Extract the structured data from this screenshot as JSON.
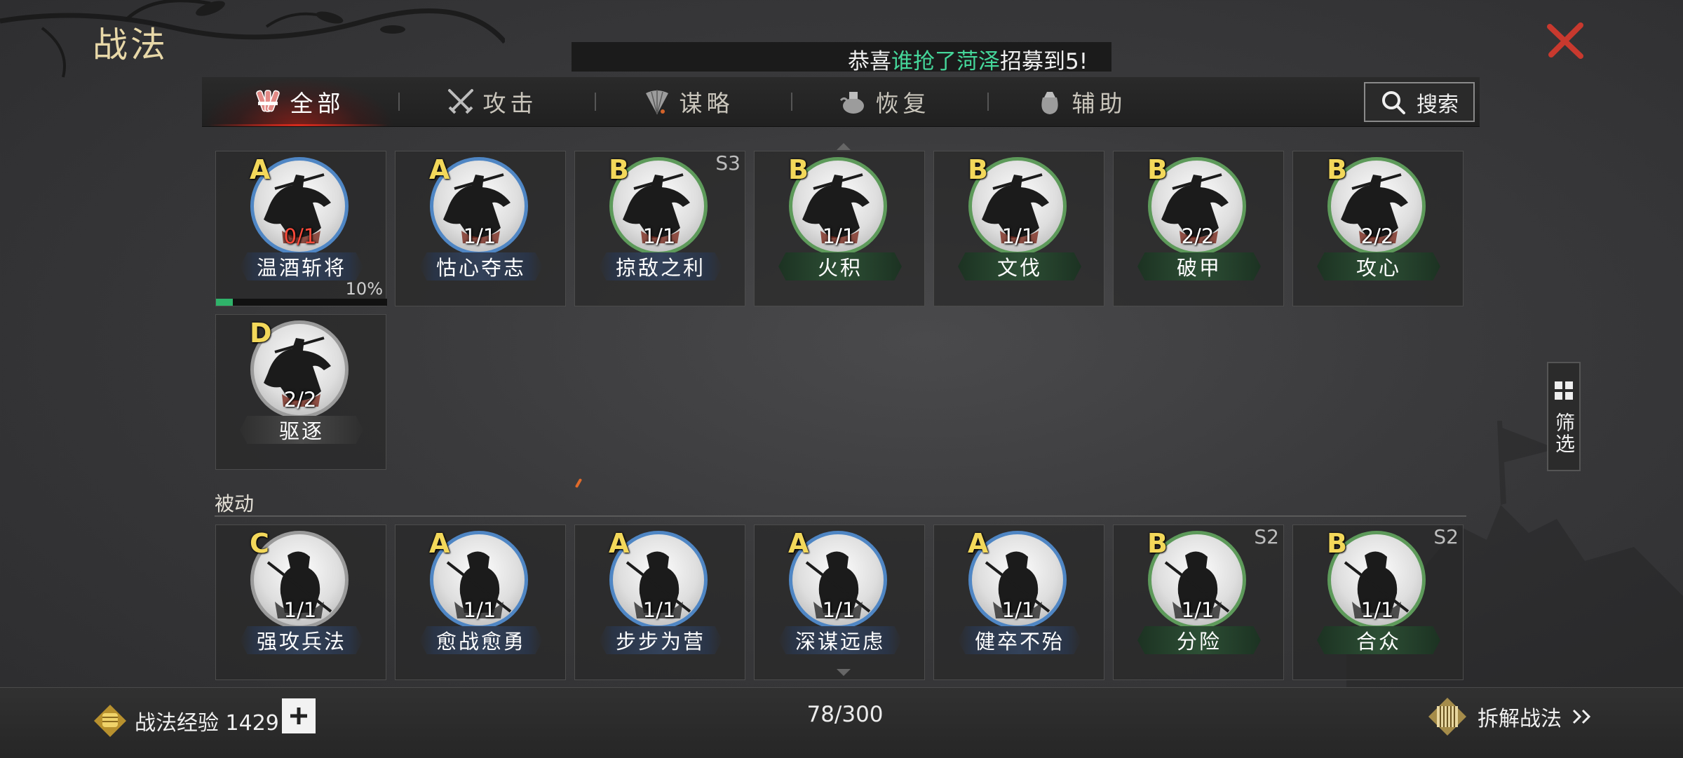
{
  "title": "战法",
  "ticker": {
    "prefix": "恭喜",
    "player": "谁抢了菏泽",
    "suffix": "招募到5!"
  },
  "tabs": [
    {
      "label": "全部",
      "icon": "scroll-bundle-icon"
    },
    {
      "label": "攻击",
      "icon": "crossed-swords-icon"
    },
    {
      "label": "谋略",
      "icon": "feather-fan-icon"
    },
    {
      "label": "恢复",
      "icon": "medicine-pot-icon"
    },
    {
      "label": "辅助",
      "icon": "pouch-icon"
    }
  ],
  "search": {
    "label": "搜索"
  },
  "active_skills": [
    {
      "grade": "A",
      "count": "0/1",
      "name": "温酒斩将",
      "progress": "10%",
      "progress_value": 0.1
    },
    {
      "grade": "A",
      "count": "1/1",
      "name": "怙心夺志"
    },
    {
      "grade": "B",
      "count": "1/1",
      "name": "掠敌之利",
      "season": "S3"
    },
    {
      "grade": "B",
      "count": "1/1",
      "name": "火积"
    },
    {
      "grade": "B",
      "count": "1/1",
      "name": "文伐"
    },
    {
      "grade": "B",
      "count": "2/2",
      "name": "破甲"
    },
    {
      "grade": "B",
      "count": "2/2",
      "name": "攻心"
    },
    {
      "grade": "D",
      "count": "2/2",
      "name": "驱逐"
    }
  ],
  "passive_section": {
    "label": "被动"
  },
  "passive_skills": [
    {
      "grade": "C",
      "count": "1/1",
      "name": "强攻兵法"
    },
    {
      "grade": "A",
      "count": "1/1",
      "name": "愈战愈勇"
    },
    {
      "grade": "A",
      "count": "1/1",
      "name": "步步为营"
    },
    {
      "grade": "A",
      "count": "1/1",
      "name": "深谋远虑"
    },
    {
      "grade": "A",
      "count": "1/1",
      "name": "健卒不殆"
    },
    {
      "grade": "B",
      "count": "1/1",
      "name": "分险",
      "season": "S2"
    },
    {
      "grade": "B",
      "count": "1/1",
      "name": "合众",
      "season": "S2"
    }
  ],
  "filter": {
    "label": "筛选"
  },
  "footer": {
    "exp_label": "战法经验 1429",
    "capacity": "78/300",
    "dismantle_label": "拆解战法"
  },
  "colors": {
    "grade_a_ring": "#4f86c4",
    "grade_b_ring": "#5d9a5a",
    "grade_c_ring": "#9a9a9a",
    "grade_letter": "#f3d85a",
    "close_red": "#c8392e",
    "ticker_green": "#45d69a",
    "progress_green": "#2fb36a"
  }
}
